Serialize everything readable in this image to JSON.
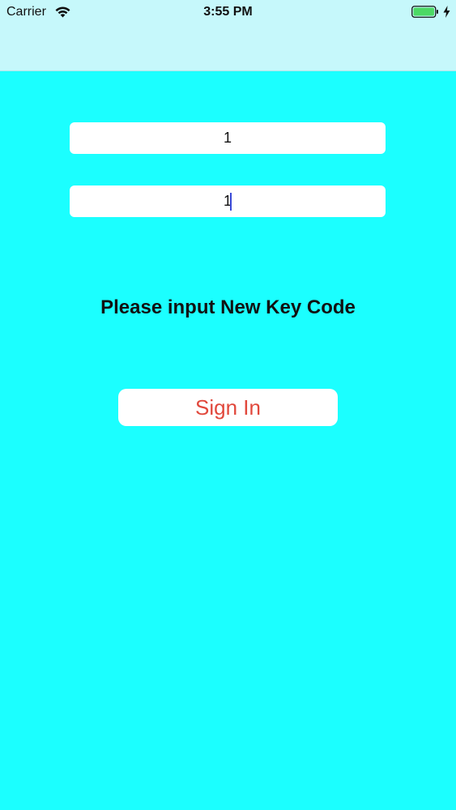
{
  "status_bar": {
    "carrier": "Carrier",
    "time": "3:55 PM",
    "icons": [
      "wifi-icon",
      "battery-icon",
      "charging-bolt-icon"
    ]
  },
  "form": {
    "field1_value": "1",
    "field2_value": "1",
    "prompt": "Please input New Key Code",
    "signin_label": "Sign In"
  },
  "colors": {
    "background": "#1bffff",
    "nav_bar": "#c6f8fb",
    "button_text": "#e1483c",
    "battery_fill": "#4cd964",
    "caret": "#3a4ad8"
  }
}
